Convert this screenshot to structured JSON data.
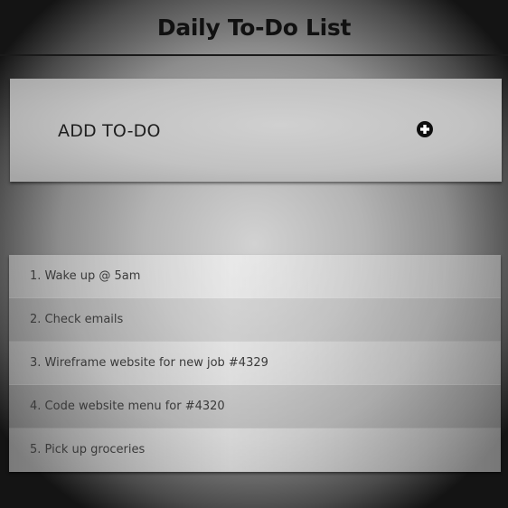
{
  "header": {
    "title": "Daily To-Do List"
  },
  "add_todo": {
    "label": "ADD TO-DO",
    "icon": "plus-circle-icon"
  },
  "todos": [
    {
      "text": "1. Wake up @ 5am"
    },
    {
      "text": "2. Check emails"
    },
    {
      "text": "3. Wireframe website for new job #4329"
    },
    {
      "text": "4. Code website menu for #4320"
    },
    {
      "text": "5. Pick up groceries"
    }
  ]
}
